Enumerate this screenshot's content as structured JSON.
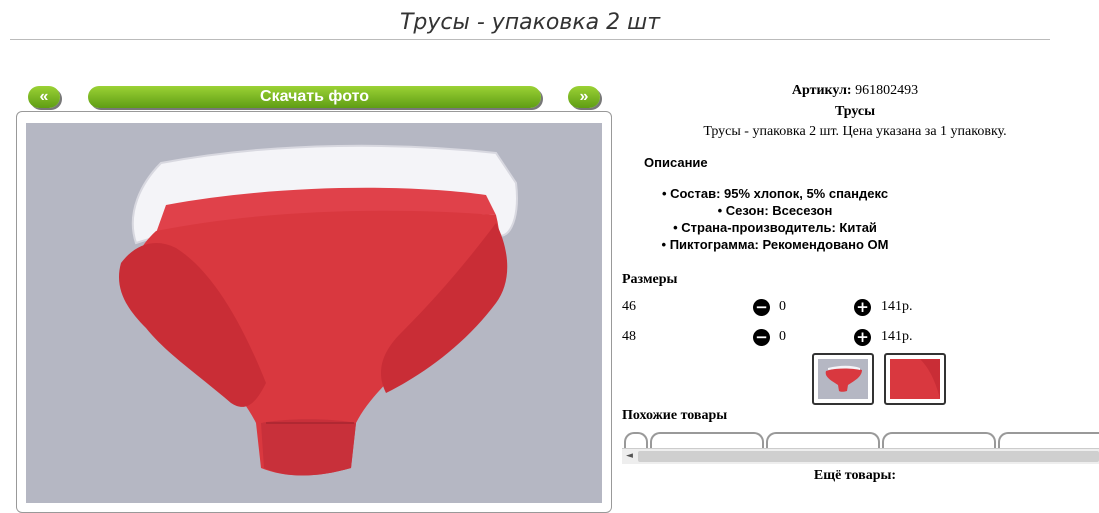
{
  "page": {
    "title": "Трусы - упаковка 2 шт"
  },
  "gallery": {
    "prev_label": "«",
    "download_label": "Скачать фото",
    "next_label": "»"
  },
  "product": {
    "article_label": "Артикул:",
    "article_value": "961802493",
    "category": "Трусы",
    "summary": "Трусы - упаковка 2 шт. Цена указана за 1 упаковку."
  },
  "description": {
    "heading": "Описание",
    "features": [
      "Состав: 95% хлопок, 5% спандекс",
      "Сезон: Всесезон",
      "Страна-производитель: Китай",
      "Пиктограмма: Рекомендовано ОМ"
    ]
  },
  "sizes": {
    "heading": "Размеры",
    "rows": [
      {
        "size": "46",
        "minus": "−",
        "qty": "0",
        "plus": "+",
        "price": "141р."
      },
      {
        "size": "48",
        "minus": "−",
        "qty": "0",
        "plus": "+",
        "price": "141р."
      }
    ]
  },
  "similar": {
    "heading": "Похожие товары",
    "scroll_left": "◄"
  },
  "more": {
    "label": "Ещё товары:"
  },
  "colors": {
    "accent_green": "#6aa91a",
    "product_red": "#d9383f",
    "photo_bg": "#b5b7c3"
  }
}
